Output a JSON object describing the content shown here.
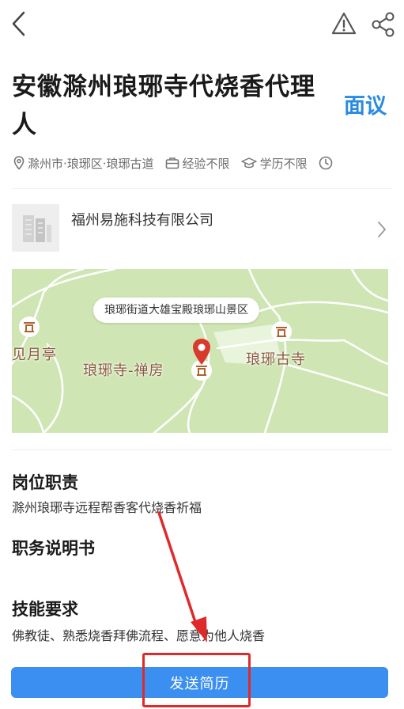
{
  "header": {
    "back_icon": "chevron-left-icon",
    "report_icon": "warning-triangle-icon",
    "share_icon": "share-icon"
  },
  "job": {
    "title": "安徽滁州琅琊寺代烧香代理人",
    "salary": "面议",
    "location": "滁州市·琅琊区·琅琊古道",
    "experience": "经验不限",
    "education": "学历不限"
  },
  "company": {
    "name": "福州易施科技有限公司"
  },
  "map": {
    "address": "琅琊街道大雄宝殿琅琊山景区",
    "labels": {
      "left_poi": "见月亭",
      "center_poi": "琅琊寺-禅房",
      "right_poi": "琅琊古寺"
    },
    "colors": {
      "land": "#cfe6b4",
      "road": "#ffffff",
      "pin": "#d93a2b"
    }
  },
  "sections": {
    "duties_title": "岗位职责",
    "duties_text": "滁州琅琊寺远程帮香客代烧香祈福",
    "jd_title": "职务说明书",
    "skills_title": "技能要求",
    "skills_text": "佛教徒、熟悉烧香拜佛流程、愿意为他人烧香"
  },
  "footer": {
    "apply_label": "发送简历"
  },
  "theme": {
    "accent": "#3b8ff0",
    "salary_color": "#2a8be0",
    "annotation_red": "#e02a2a"
  }
}
